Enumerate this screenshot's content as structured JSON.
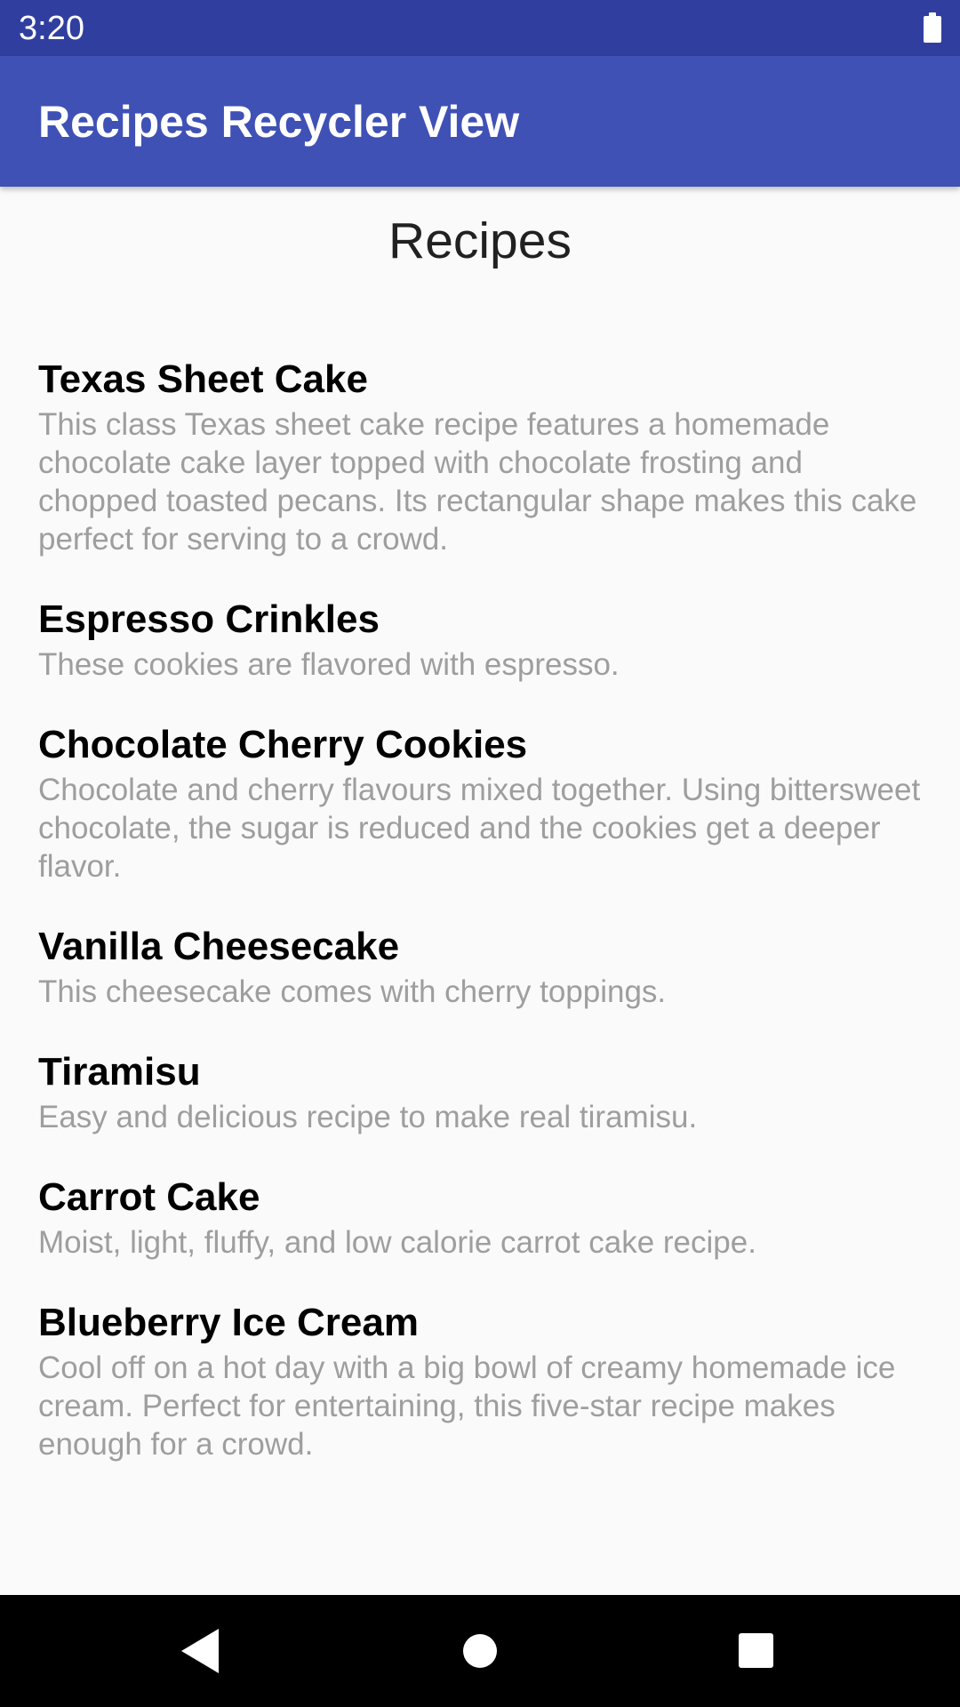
{
  "status_bar": {
    "time": "3:20",
    "battery_icon": "battery-full-icon"
  },
  "app_bar": {
    "title": "Recipes Recycler View",
    "color": "#3f51b5",
    "status_color": "#303f9f"
  },
  "main": {
    "heading": "Recipes",
    "recipes": [
      {
        "title": "Texas Sheet Cake",
        "description": "This class Texas sheet cake recipe features a homemade chocolate cake layer topped with chocolate frosting and chopped toasted pecans.  Its rectangular shape makes this cake perfect for serving to a crowd."
      },
      {
        "title": "Espresso Crinkles",
        "description": "These cookies are flavored with espresso."
      },
      {
        "title": "Chocolate Cherry Cookies",
        "description": "Chocolate and cherry flavours mixed together. Using bittersweet chocolate, the sugar is reduced and the cookies get a deeper flavor."
      },
      {
        "title": "Vanilla Cheesecake",
        "description": "This cheesecake comes with cherry toppings."
      },
      {
        "title": "Tiramisu",
        "description": "Easy and delicious recipe to make real tiramisu."
      },
      {
        "title": "Carrot Cake",
        "description": "Moist, light, fluffy, and low calorie carrot cake recipe."
      },
      {
        "title": "Blueberry Ice Cream",
        "description": "Cool off on a hot day with a big bowl of creamy homemade ice cream. Perfect for entertaining, this five-star recipe makes enough for a crowd."
      }
    ]
  },
  "nav_bar": {
    "buttons": [
      {
        "name": "back",
        "icon": "back-triangle-icon"
      },
      {
        "name": "home",
        "icon": "home-circle-icon"
      },
      {
        "name": "recents",
        "icon": "recents-square-icon"
      }
    ]
  }
}
